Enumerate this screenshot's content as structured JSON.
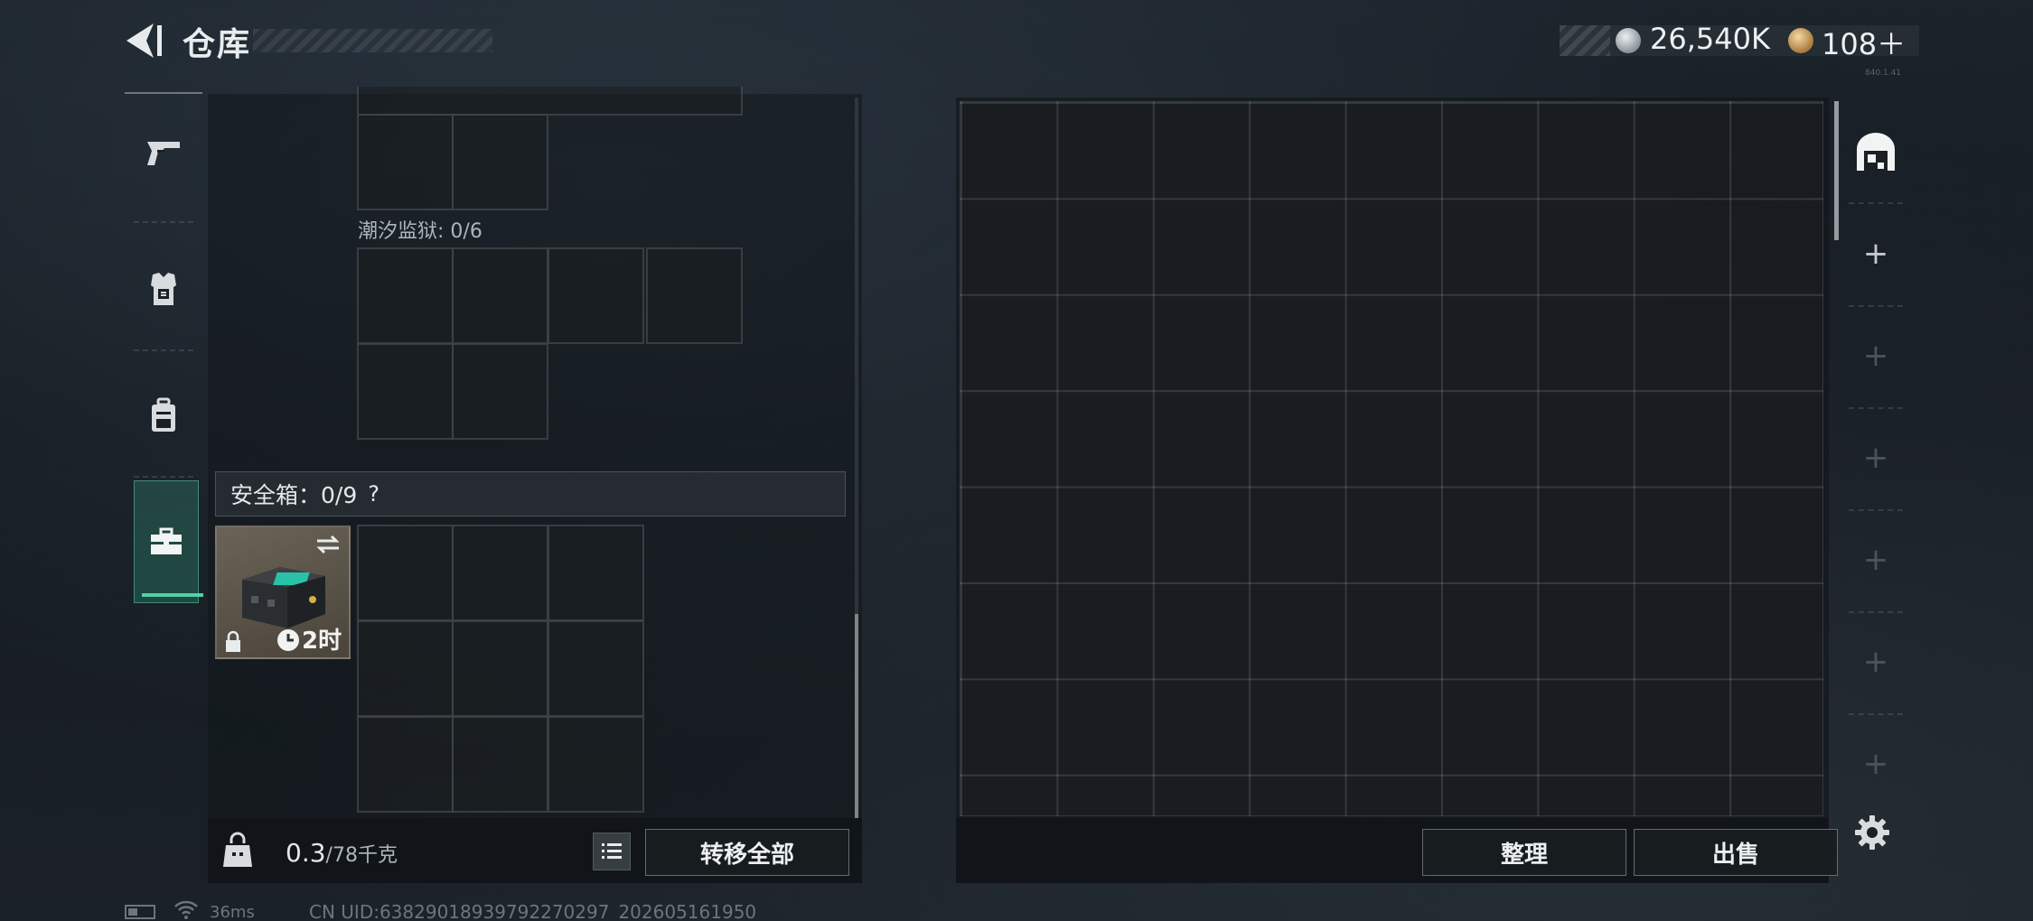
{
  "header": {
    "title": "仓库",
    "currency_silver": "26,540K",
    "currency_gold": "108＋",
    "version": "840.1.41"
  },
  "left_tabs": [
    {
      "icon": "pistol-icon",
      "active": false
    },
    {
      "icon": "armor-vest-icon",
      "active": false
    },
    {
      "icon": "backpack-icon",
      "active": false
    },
    {
      "icon": "briefcase-icon",
      "active": true
    }
  ],
  "left_panel": {
    "slot_label": "潮汐监狱: 0/6",
    "safe_label": "安全箱：0/9",
    "help": "?",
    "safe_item": {
      "timer": "2时",
      "icons": [
        "swap-icon",
        "lock-icon",
        "clock-icon"
      ]
    },
    "weight_current": "0.3",
    "weight_max": "/78千克",
    "transfer_all": "转移全部"
  },
  "right_panel": {
    "sort": "整理",
    "sell": "出售"
  },
  "right_tabs": [
    {
      "icon": "warehouse-icon",
      "active": true
    },
    {
      "icon": "plus-icon",
      "dim": false
    },
    {
      "icon": "plus-icon",
      "dim": true
    },
    {
      "icon": "plus-icon",
      "dim": true
    },
    {
      "icon": "plus-icon",
      "dim": true
    },
    {
      "icon": "plus-icon",
      "dim": true
    },
    {
      "icon": "plus-icon",
      "dim": true
    }
  ],
  "footer": {
    "ping": "36ms",
    "uid": "CN UID:638290189397922702​97_202605161950"
  }
}
